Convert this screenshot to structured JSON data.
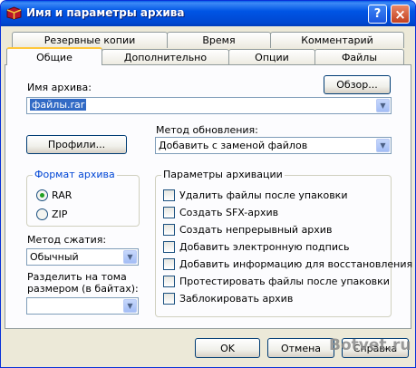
{
  "window": {
    "title": "Имя и параметры архива",
    "help_label": "?",
    "close_label": "×"
  },
  "tabs_row1": [
    {
      "label": "Резервные копии"
    },
    {
      "label": "Время"
    },
    {
      "label": "Комментарий"
    }
  ],
  "tabs_row2": [
    {
      "label": "Общие",
      "active": true
    },
    {
      "label": "Дополнительно"
    },
    {
      "label": "Опции"
    },
    {
      "label": "Файлы"
    }
  ],
  "archive_name": {
    "label": "Имя архива:",
    "value": "файлы.rar",
    "browse_label": "Обзор..."
  },
  "update_method": {
    "label": "Метод обновления:",
    "value": "Добавить с заменой файлов"
  },
  "profiles_label": "Профили...",
  "archive_format": {
    "title": "Формат архива",
    "options": [
      "RAR",
      "ZIP"
    ],
    "selected": "RAR"
  },
  "compression": {
    "label": "Метод сжатия:",
    "value": "Обычный"
  },
  "split": {
    "label_line1": "Разделить на тома",
    "label_line2": "размером (в байтах):",
    "value": ""
  },
  "archive_params": {
    "title": "Параметры архивации",
    "options": [
      "Удалить файлы после упаковки",
      "Создать SFX-архив",
      "Создать непрерывный архив",
      "Добавить электронную подпись",
      "Добавить информацию для восстановления",
      "Протестировать файлы после упаковки",
      "Заблокировать архив"
    ]
  },
  "buttons": {
    "ok": "OK",
    "cancel": "Отмена",
    "help": "Справка"
  },
  "watermark": {
    "main": "Botve",
    "suffix": "t.ru"
  }
}
